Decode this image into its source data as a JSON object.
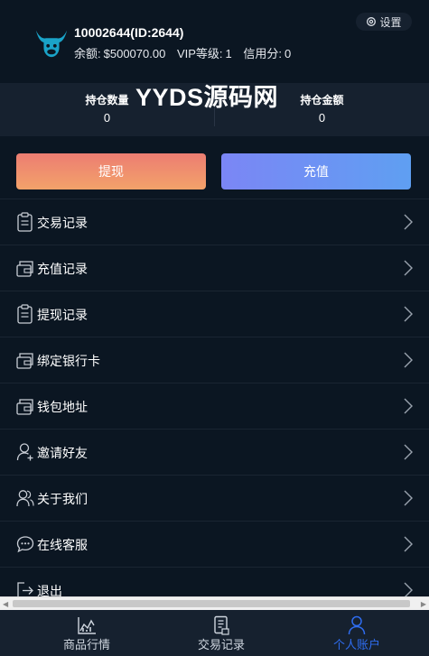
{
  "user": {
    "id_text": "10002644(ID:2644)",
    "balance_label": "余额:",
    "balance": "$500070.00",
    "vip_label": "VIP等级:",
    "vip": "1",
    "credit_label": "信用分:",
    "credit": "0"
  },
  "settings": {
    "label": "设置",
    "icon": "gear-icon"
  },
  "stats": [
    {
      "label": "持仓数量",
      "value": "0"
    },
    {
      "label": "持仓金额",
      "value": "0"
    }
  ],
  "watermark": "YYDS源码网",
  "actions": {
    "withdraw": "提现",
    "recharge": "充值"
  },
  "menu": [
    {
      "label": "交易记录",
      "icon": "clipboard-icon"
    },
    {
      "label": "充值记录",
      "icon": "wallet-icon"
    },
    {
      "label": "提现记录",
      "icon": "clipboard-icon"
    },
    {
      "label": "绑定银行卡",
      "icon": "wallet-icon"
    },
    {
      "label": "钱包地址",
      "icon": "wallet-icon"
    },
    {
      "label": "邀请好友",
      "icon": "user-add-icon"
    },
    {
      "label": "关于我们",
      "icon": "users-icon"
    },
    {
      "label": "在线客服",
      "icon": "chat-icon"
    },
    {
      "label": "退出",
      "icon": "logout-icon"
    }
  ],
  "tabs": [
    {
      "label": "商品行情",
      "icon": "chart-icon",
      "active": false
    },
    {
      "label": "交易记录",
      "icon": "document-icon",
      "active": false
    },
    {
      "label": "个人账户",
      "icon": "person-icon",
      "active": true
    }
  ],
  "colors": {
    "background": "#0b1622",
    "panel": "#16212f",
    "withdraw_gradient": [
      "#ec7d72",
      "#f3a26a"
    ],
    "recharge_gradient": [
      "#7b86f5",
      "#5f9ff2"
    ],
    "active_tab": "#2f6df0",
    "logo": "#1aa3c8"
  }
}
